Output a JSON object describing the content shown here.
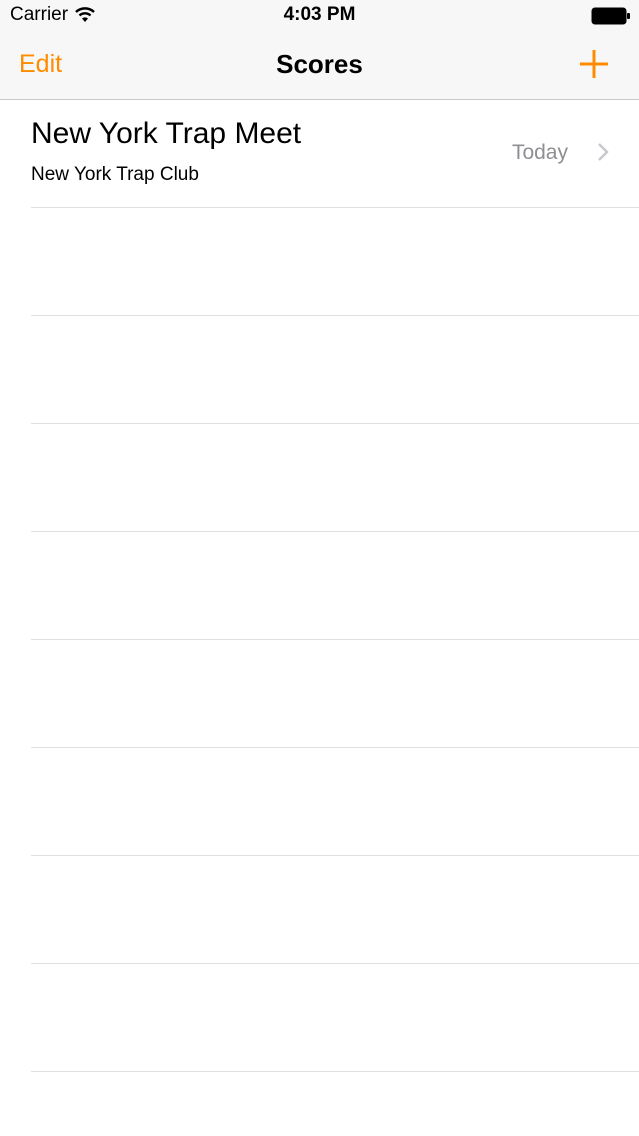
{
  "status_bar": {
    "carrier": "Carrier",
    "time": "4:03 PM",
    "icons": [
      "wifi-icon",
      "battery-icon"
    ]
  },
  "nav": {
    "edit_label": "Edit",
    "title": "Scores",
    "add_icon": "plus-icon",
    "accent_color": "#ff8c00"
  },
  "scores": [
    {
      "title": "New York Trap Meet",
      "subtitle": "New York Trap Club",
      "date": "Today",
      "icon": "chevron-right-icon"
    }
  ],
  "colors": {
    "accent": "#ff8c00",
    "detail_text": "#8e8e93",
    "separator": "#e0e0e4",
    "header_bg": "#f7f7f7"
  }
}
